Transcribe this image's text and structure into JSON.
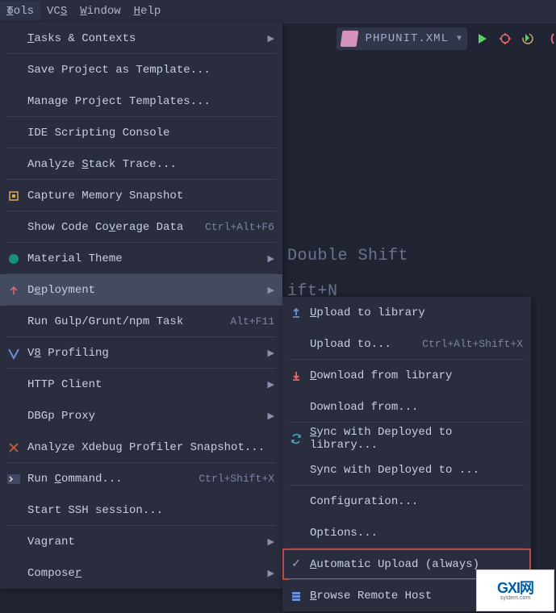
{
  "menubar": {
    "tools": "Tools",
    "vcs": "VCS",
    "window": "Window",
    "help": "Help"
  },
  "toolbar": {
    "config_label": "PHPUNIT.XML"
  },
  "menu": {
    "tasks": "Tasks & Contexts",
    "saveTemplate": "Save Project as Template...",
    "manageTemplates": "Manage Project Templates...",
    "scripting": "IDE Scripting Console",
    "stack": "Analyze Stack Trace...",
    "capture": "Capture Memory Snapshot",
    "coverage": "Show Code Coverage Data",
    "coverage_sc": "Ctrl+Alt+F6",
    "material": "Material Theme",
    "deployment": "Deployment",
    "gulp": "Run Gulp/Grunt/npm Task",
    "gulp_sc": "Alt+F11",
    "v8": "V8 Profiling",
    "http": "HTTP Client",
    "dbgp": "DBGp Proxy",
    "xdebug": "Analyze Xdebug Profiler Snapshot...",
    "runcmd": "Run Command...",
    "runcmd_sc": "Ctrl+Shift+X",
    "ssh": "Start SSH session...",
    "vagrant": "Vagrant",
    "composer": "Composer"
  },
  "submenu": {
    "upload": "Upload to library",
    "uploadto": "Upload to...",
    "uploadto_sc": "Ctrl+Alt+Shift+X",
    "download": "Download from library",
    "downloadfrom": "Download from...",
    "sync": "Sync with Deployed to library...",
    "syncwith": "Sync with Deployed to ...",
    "config": "Configuration...",
    "options": "Options...",
    "auto": "Automatic Upload (always)",
    "browse": "Browse Remote Host"
  },
  "bg": {
    "shift": "Double Shift",
    "shiftn": "ift+N"
  },
  "watermark": {
    "brand": "GXI网",
    "url": "system.com"
  }
}
